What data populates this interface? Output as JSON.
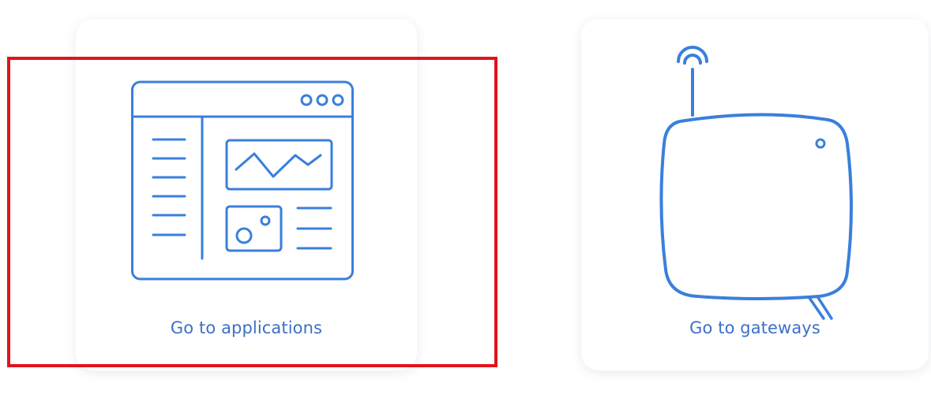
{
  "cards": {
    "applications": {
      "label": "Go to applications",
      "icon": "application-window-icon"
    },
    "gateways": {
      "label": "Go to gateways",
      "icon": "gateway-device-icon"
    }
  },
  "colors": {
    "icon_stroke": "#3a7fdc",
    "label_text": "#3c6fc9",
    "highlight": "#e0141b",
    "card_background": "#ffffff"
  }
}
